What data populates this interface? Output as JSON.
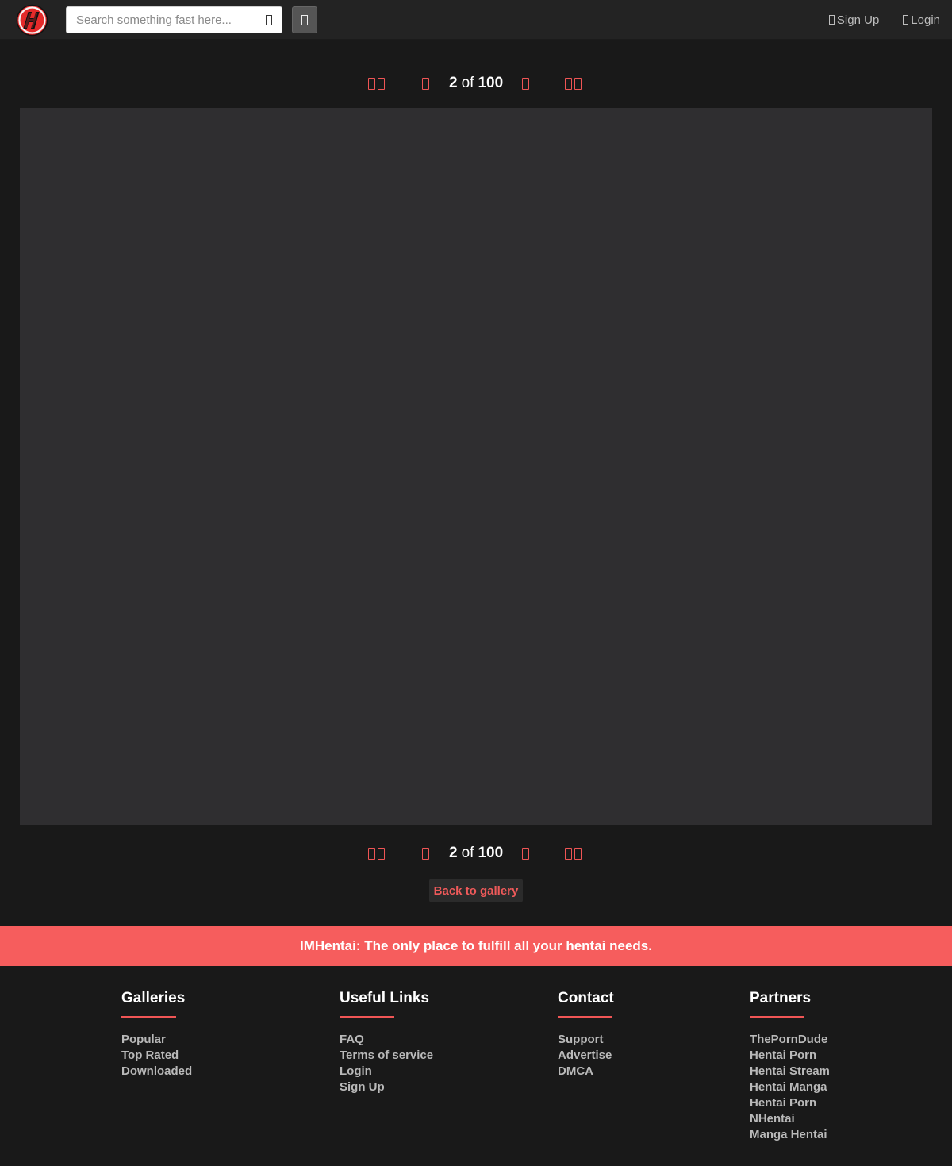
{
  "header": {
    "search_placeholder": "Search something fast here...",
    "nav": {
      "signup_label": "Sign Up",
      "login_label": "Login"
    }
  },
  "pager": {
    "current": "2",
    "of_label": "of",
    "total": "100"
  },
  "back_to_gallery": "Back to gallery",
  "banner_text": "IMHentai: The only place to fulfill all your hentai needs.",
  "footer": {
    "galleries": {
      "title": "Galleries",
      "links": [
        "Popular",
        "Top Rated",
        "Downloaded"
      ]
    },
    "useful_links": {
      "title": "Useful Links",
      "links": [
        "FAQ",
        "Terms of service",
        "Login",
        "Sign Up"
      ]
    },
    "contact": {
      "title": "Contact",
      "links": [
        "Support",
        "Advertise",
        "DMCA"
      ]
    },
    "partners": {
      "title": "Partners",
      "links": [
        "ThePornDude",
        "Hentai Porn",
        "Hentai Stream",
        "Hentai Manga",
        "Hentai Porn",
        "NHentai",
        "Manga Hentai"
      ]
    }
  },
  "colors": {
    "accent": "#f05555",
    "banner": "#f65d5d",
    "background": "#191919",
    "header": "#232323",
    "image_placeholder": "#2f2e30"
  },
  "icons": {
    "logo": "site-logo-h",
    "search": "search-icon",
    "filter": "filter-icon",
    "signup": "user-plus-icon",
    "login": "sign-in-icon",
    "first": "double-chevron-left-icon",
    "prev": "chevron-left-icon",
    "next": "chevron-right-icon",
    "last": "double-chevron-right-icon"
  }
}
